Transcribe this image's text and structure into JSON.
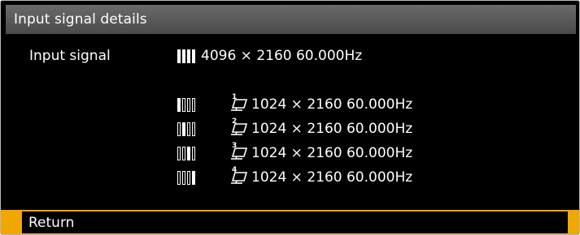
{
  "window": {
    "title": "Input signal details"
  },
  "main": {
    "input_signal_label": "Input signal",
    "input_signal_value": "4096 × 2160 60.000Hz",
    "sub_signals": [
      {
        "index": "1",
        "value": "1024 × 2160 60.000Hz",
        "active_bar": 0
      },
      {
        "index": "2",
        "value": "1024 × 2160 60.000Hz",
        "active_bar": 1
      },
      {
        "index": "3",
        "value": "1024 × 2160 60.000Hz",
        "active_bar": 2
      },
      {
        "index": "4",
        "value": "1024 × 2160 60.000Hz",
        "active_bar": 3
      }
    ]
  },
  "footer": {
    "return_label": "Return"
  },
  "colors": {
    "background": "#000000",
    "title_bar": "#5a5a5a",
    "highlight": "#f0a800",
    "text": "#ffffff"
  },
  "icons": {
    "all_bars": "four-bars-icon",
    "single_bar": "single-bar-highlight-icon",
    "sub_signal": "display-stand-icon"
  }
}
